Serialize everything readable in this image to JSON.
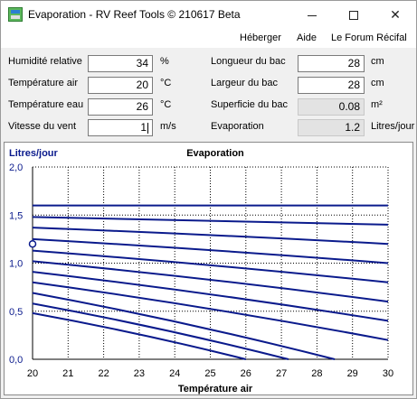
{
  "window": {
    "title": "Evaporation - RV Reef Tools © 210617 Beta",
    "minimize_glyph": "–",
    "maximize_glyph": "□",
    "close_glyph": "✕"
  },
  "menu": [
    "Héberger",
    "Aide",
    "Le Forum Récifal"
  ],
  "form": {
    "humidity": {
      "label": "Humidité relative",
      "value": "34",
      "unit": "%"
    },
    "air_temp": {
      "label": "Température air",
      "value": "20",
      "unit": "°C"
    },
    "water_temp": {
      "label": "Température eau",
      "value": "26",
      "unit": "°C"
    },
    "wind_speed": {
      "label": "Vitesse du vent",
      "value": "1",
      "unit": "m/s"
    },
    "tank_length": {
      "label": "Longueur du bac",
      "value": "28",
      "unit": "cm"
    },
    "tank_width": {
      "label": "Largeur du bac",
      "value": "28",
      "unit": "cm"
    },
    "surface": {
      "label": "Superficie du bac",
      "value": "0.08",
      "unit": "m²"
    },
    "evaporation": {
      "label": "Evaporation",
      "value": "1.2",
      "unit": "Litres/jour"
    }
  },
  "chart_data": {
    "type": "line",
    "title": "Evaporation",
    "ylabel": "Litres/jour",
    "xlabel": "Température air",
    "xlim": [
      20,
      30
    ],
    "ylim": [
      0,
      2
    ],
    "x_ticks": [
      "20",
      "21",
      "22",
      "23",
      "24",
      "25",
      "26",
      "27",
      "28",
      "29",
      "30"
    ],
    "y_ticks": [
      "0,0",
      "0,5",
      "1,0",
      "1,5",
      "2,0"
    ],
    "grid": true,
    "line_color": "#0a1a8c",
    "marker": {
      "x": 20,
      "y": 1.2
    },
    "series": [
      {
        "x": [
          20,
          30
        ],
        "values": [
          1.6,
          1.6
        ]
      },
      {
        "x": [
          20,
          30
        ],
        "values": [
          1.48,
          1.4
        ]
      },
      {
        "x": [
          20,
          30
        ],
        "values": [
          1.37,
          1.2
        ]
      },
      {
        "x": [
          20,
          30
        ],
        "values": [
          1.25,
          1.0
        ]
      },
      {
        "x": [
          20,
          30
        ],
        "values": [
          1.13,
          0.8
        ]
      },
      {
        "x": [
          20,
          30
        ],
        "values": [
          1.02,
          0.6
        ]
      },
      {
        "x": [
          20,
          30
        ],
        "values": [
          0.91,
          0.4
        ]
      },
      {
        "x": [
          20,
          30
        ],
        "values": [
          0.8,
          0.2
        ]
      },
      {
        "x": [
          20,
          28.5
        ],
        "values": [
          0.69,
          0.0
        ]
      },
      {
        "x": [
          20,
          27.2
        ],
        "values": [
          0.58,
          0.0
        ]
      },
      {
        "x": [
          20,
          26.0
        ],
        "values": [
          0.48,
          0.0
        ]
      }
    ]
  }
}
